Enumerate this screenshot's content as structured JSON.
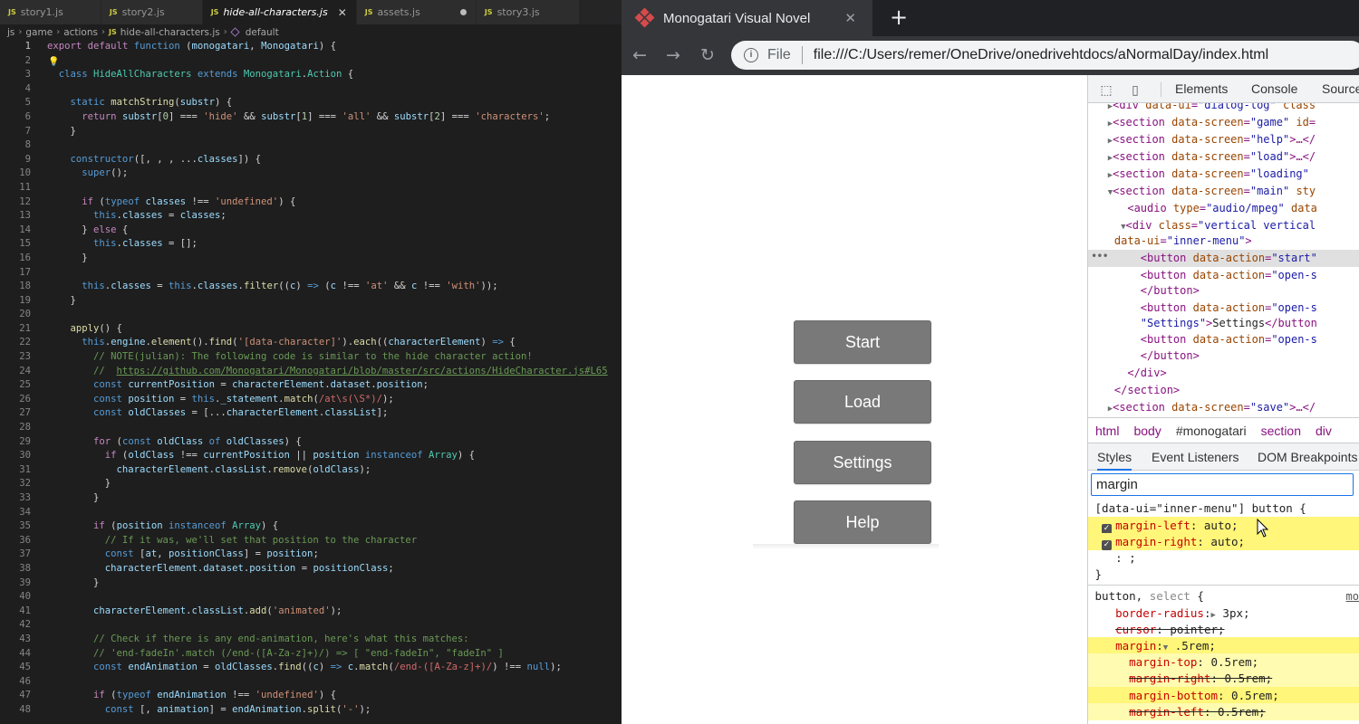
{
  "editor": {
    "tabs": [
      {
        "badge": "JS",
        "label": "story1.js"
      },
      {
        "badge": "JS",
        "label": "story2.js"
      },
      {
        "badge": "JS",
        "label": "hide-all-characters.js"
      },
      {
        "badge": "JS",
        "label": "assets.js"
      },
      {
        "badge": "JS",
        "label": "story3.js"
      }
    ],
    "breadcrumb": {
      "p1": "js",
      "p2": "game",
      "p3": "actions",
      "badge": "JS",
      "file": "hide-all-characters.js",
      "symbol": "default"
    },
    "line_numbers": [
      "1",
      "2",
      "3",
      "4",
      "5",
      "6",
      "7",
      "8",
      "9",
      "10",
      "11",
      "12",
      "13",
      "14",
      "15",
      "16",
      "17",
      "18",
      "19",
      "20",
      "21",
      "22",
      "23",
      "24",
      "25",
      "26",
      "27",
      "28",
      "29",
      "30",
      "31",
      "32",
      "33",
      "34",
      "35",
      "36",
      "37",
      "38",
      "39",
      "40",
      "41",
      "42",
      "43",
      "44",
      "45",
      "46",
      "47",
      "48"
    ]
  },
  "browser": {
    "tab_title": "Monogatari Visual Novel",
    "new_tab": "+",
    "file_label": "File",
    "url": "file:///C:/Users/remer/OneDrive/onedrivehtdocs/aNormalDay/index.html",
    "menu": {
      "start": "Start",
      "load": "Load",
      "settings": "Settings",
      "help": "Help"
    }
  },
  "devtools": {
    "tabs": {
      "elements": "Elements",
      "console": "Console",
      "sources": "Sources"
    },
    "crumbs": {
      "html": "html",
      "body": "body",
      "id": "#monogatari",
      "section": "section",
      "div": "div"
    },
    "style_tabs": {
      "styles": "Styles",
      "events": "Event Listeners",
      "dom": "DOM Breakpoints"
    },
    "filter_value": "margin",
    "origin": "mo"
  }
}
